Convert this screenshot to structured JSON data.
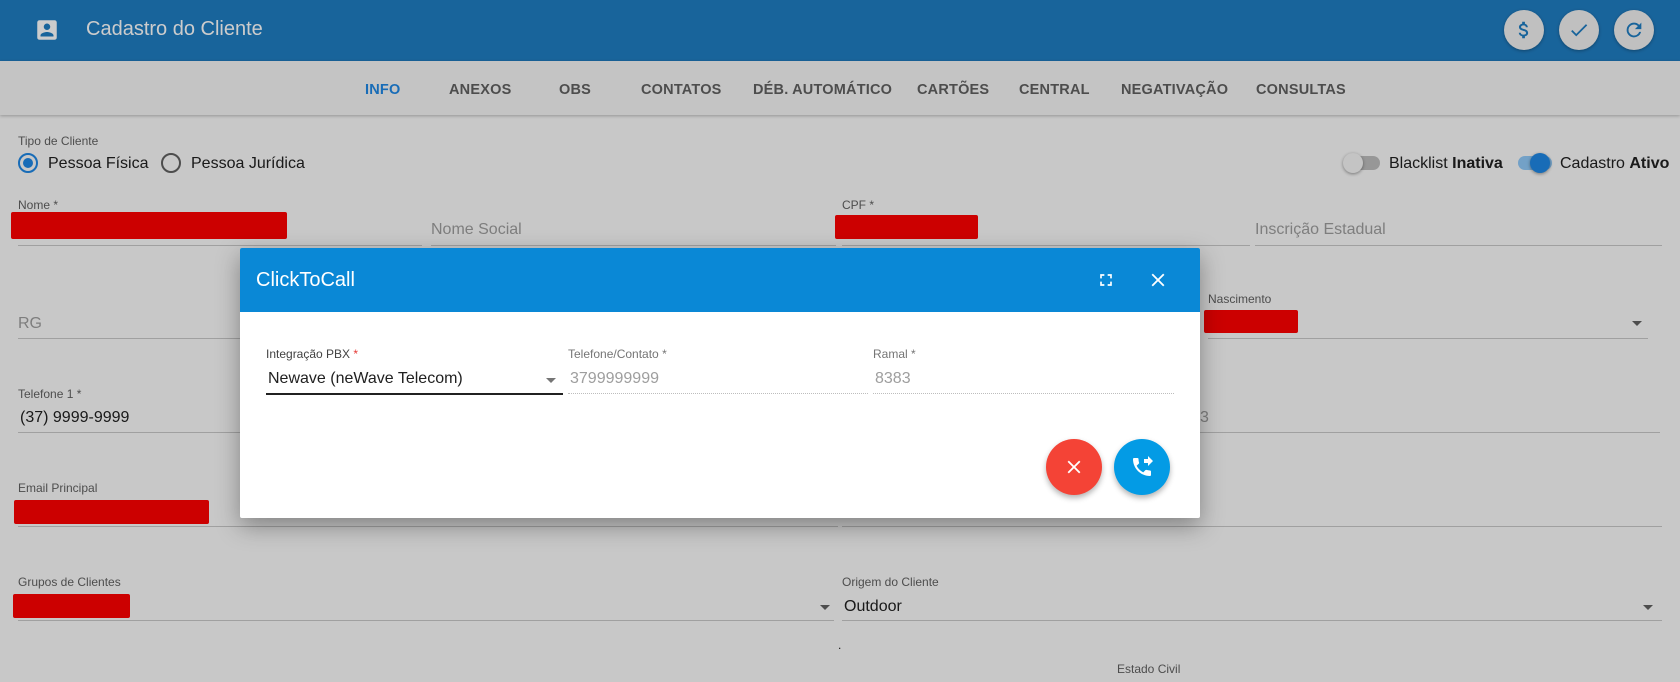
{
  "header": {
    "title": "Cadastro do Cliente",
    "icons": [
      "account-box-icon",
      "dollar-icon",
      "check-icon",
      "refresh-icon"
    ]
  },
  "tabs": [
    {
      "label": "INFO",
      "active": true
    },
    {
      "label": "ANEXOS"
    },
    {
      "label": "OBS"
    },
    {
      "label": "CONTATOS"
    },
    {
      "label": "DÉB. AUTOMÁTICO"
    },
    {
      "label": "CARTÕES"
    },
    {
      "label": "CENTRAL"
    },
    {
      "label": "NEGATIVAÇÃO"
    },
    {
      "label": "CONSULTAS"
    }
  ],
  "form": {
    "tipo_label": "Tipo de Cliente",
    "pessoa_fisica": "Pessoa Física",
    "pessoa_juridica": "Pessoa Jurídica",
    "blacklist_prefix": "Blacklist",
    "blacklist_state": "Inativa",
    "cadastro_prefix": "Cadastro",
    "cadastro_state": "Ativo",
    "nome_label": "Nome *",
    "nome_social_placeholder": "Nome Social",
    "cpf_label": "CPF *",
    "inscricao_placeholder": "Inscrição Estadual",
    "rg_placeholder": "RG",
    "nascimento_label": "Nascimento",
    "telefone1_label": "Telefone 1 *",
    "telefone1_value": "(37) 9999-9999",
    "partial_value": "3",
    "email_label": "Email Principal",
    "grupos_label": "Grupos de Clientes",
    "origem_label": "Origem do Cliente",
    "origem_value": "Outdoor",
    "dot": ".",
    "estado_civil_label": "Estado Civil"
  },
  "dialog": {
    "title": "ClickToCall",
    "integracao_label": "Integração PBX",
    "integracao_value": "Newave (neWave Telecom)",
    "telefone_label": "Telefone/Contato",
    "telefone_value": "3799999999",
    "ramal_label": "Ramal",
    "ramal_value": "8383",
    "required_mark": "*"
  },
  "colors": {
    "header": "#1f7dc2",
    "dialog_header": "#0a88d6",
    "accent": "#1e88e5",
    "cancel_fab": "#f44336",
    "call_fab": "#039be5"
  }
}
